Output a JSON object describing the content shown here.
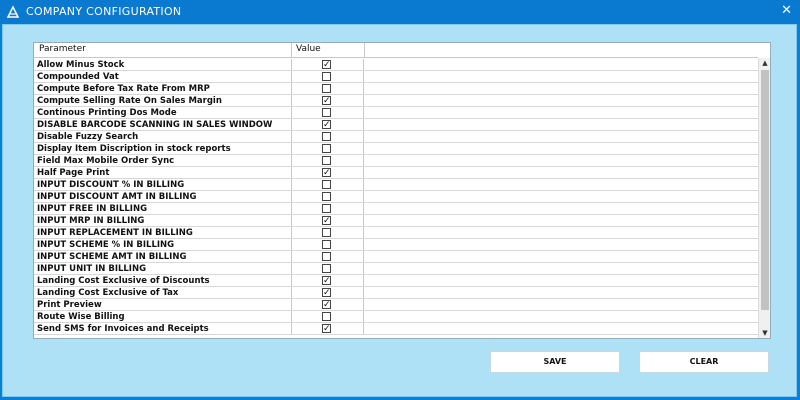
{
  "window": {
    "title": "COMPANY CONFIGURATION",
    "close_glyph": "✕"
  },
  "grid": {
    "columns": [
      "Parameter",
      "Value"
    ],
    "rows": [
      {
        "label": "Allow Minus Stock",
        "checked": true
      },
      {
        "label": "Compounded Vat",
        "checked": false
      },
      {
        "label": "Compute Before Tax Rate From MRP",
        "checked": false
      },
      {
        "label": "Compute Selling Rate On Sales Margin",
        "checked": true
      },
      {
        "label": "Continous Printing Dos Mode",
        "checked": false
      },
      {
        "label": "DISABLE BARCODE SCANNING IN SALES WINDOW",
        "checked": true
      },
      {
        "label": "Disable Fuzzy Search",
        "checked": false
      },
      {
        "label": "Display Item Discription in stock reports",
        "checked": false
      },
      {
        "label": "Field Max Mobile Order Sync",
        "checked": false
      },
      {
        "label": "Half Page Print",
        "checked": true
      },
      {
        "label": "INPUT DISCOUNT % IN BILLING",
        "checked": false
      },
      {
        "label": "INPUT DISCOUNT AMT IN BILLING",
        "checked": false
      },
      {
        "label": "INPUT FREE IN BILLING",
        "checked": false
      },
      {
        "label": "INPUT MRP IN BILLING",
        "checked": true
      },
      {
        "label": "INPUT REPLACEMENT IN BILLING",
        "checked": false
      },
      {
        "label": "INPUT SCHEME % IN BILLING",
        "checked": false
      },
      {
        "label": "INPUT SCHEME AMT IN BILLING",
        "checked": false
      },
      {
        "label": "INPUT UNIT IN BILLING",
        "checked": false
      },
      {
        "label": "Landing Cost Exclusive of Discounts",
        "checked": true
      },
      {
        "label": "Landing Cost Exclusive of Tax",
        "checked": true
      },
      {
        "label": "Print Preview",
        "checked": true
      },
      {
        "label": "Route Wise Billing",
        "checked": false
      },
      {
        "label": "Send SMS for Invoices and Receipts",
        "checked": true
      }
    ]
  },
  "buttons": {
    "save": "SAVE",
    "clear": "CLEAR"
  },
  "icons": {
    "app": "app-logo-icon",
    "close": "close-icon",
    "check": "checkmark-icon"
  }
}
